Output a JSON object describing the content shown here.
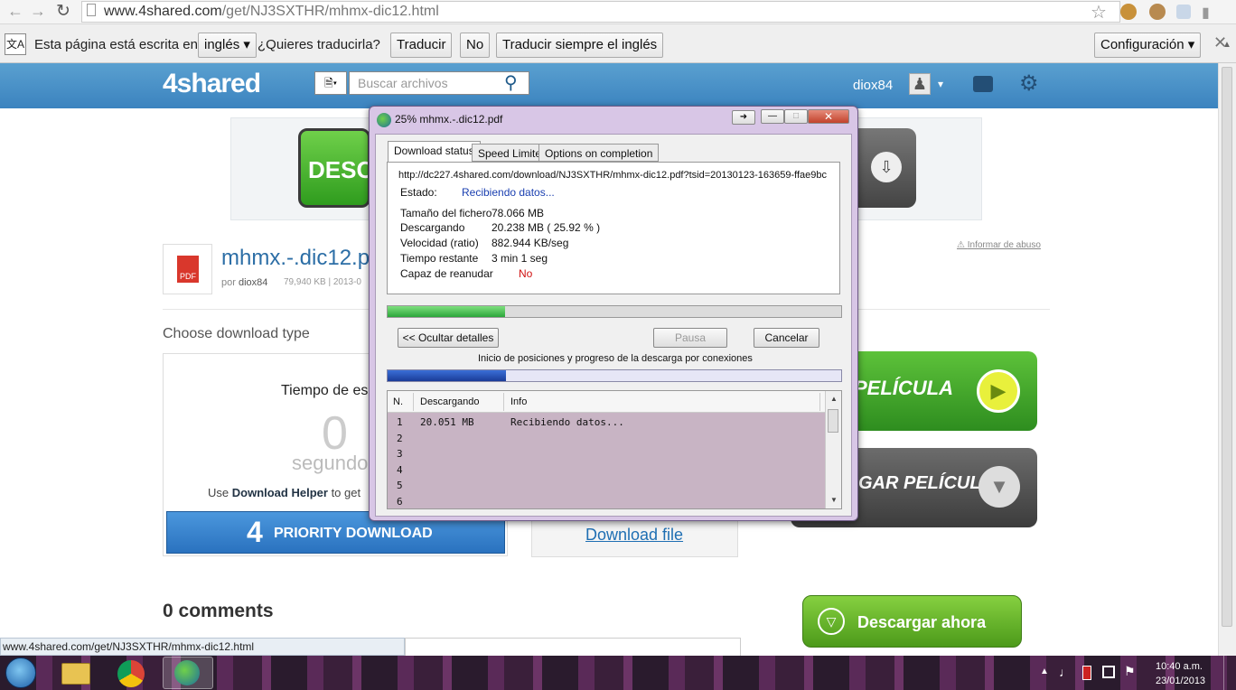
{
  "browser": {
    "url_host": "www.4shared.com",
    "url_path": "/get/NJ3SXTHR/mhmx-dic12.html"
  },
  "translate": {
    "prefix": "Esta página está escrita en",
    "language": "inglés",
    "question": "¿Quieres traducirla?",
    "translate_btn": "Traducir",
    "no_btn": "No",
    "always_btn": "Traducir siempre el inglés",
    "settings_btn": "Configuración"
  },
  "site": {
    "logo": "4shared",
    "search_placeholder": "Buscar archivos",
    "username": "diox84"
  },
  "file": {
    "title": "mhmx.-.dic12.p",
    "by_label": "por",
    "author": "diox84",
    "meta": "79,940 KB | 2013-0",
    "report": "Informar de abuso",
    "banner_text": "DESCA"
  },
  "download": {
    "choose_type": "Choose download type",
    "wait_label": "Tiempo de esp",
    "wait_value": "0",
    "wait_unit": "segundo",
    "helper_prefix": "Use",
    "helper_link": "Download Helper",
    "helper_suffix": "to get",
    "priority_number": "4",
    "priority_label": "PRIORITY DOWNLOAD",
    "download_file": "Download file",
    "movie_label": "PELÍCULA",
    "movie_label2": "GAR PELÍCULA",
    "download_now": "Descargar ahora"
  },
  "comments": {
    "title": "0 comments"
  },
  "status_url": "www.4shared.com/get/NJ3SXTHR/mhmx-dic12.html",
  "dialog": {
    "title": "25% mhmx.-.dic12.pdf",
    "tabs": [
      "Download status",
      "Speed Limiter",
      "Options on completion"
    ],
    "url": "http://dc227.4shared.com/download/NJ3SXTHR/mhmx-dic12.pdf?tsid=20130123-163659-ffae9bc",
    "estado_label": "Estado:",
    "estado_value": "Recibiendo datos...",
    "rows": [
      {
        "label": "Tamaño del fichero",
        "value": "78.066  MB"
      },
      {
        "label": "Descargando",
        "value": "20.238  MB  ( 25.92 % )"
      },
      {
        "label": "Velocidad (ratio)",
        "value": "882.944  KB/seg"
      },
      {
        "label": "Tiempo restante",
        "value": "3 min 1 seg"
      }
    ],
    "resume_label": "Capaz de reanudar",
    "resume_value": "No",
    "progress": 0.2592,
    "hide_details": "<< Ocultar detalles",
    "pause": "Pausa",
    "cancel": "Cancelar",
    "connections_caption": "Inicio de posiciones y progreso de la descarga por conexiones",
    "conn_progress": 0.26,
    "table_headers": [
      "N.",
      "Descargando",
      "Info"
    ],
    "table_rows": [
      {
        "n": "1",
        "dl": "20.051  MB",
        "info": "Recibiendo datos..."
      },
      {
        "n": "2",
        "dl": "",
        "info": ""
      },
      {
        "n": "3",
        "dl": "",
        "info": ""
      },
      {
        "n": "4",
        "dl": "",
        "info": ""
      },
      {
        "n": "5",
        "dl": "",
        "info": ""
      },
      {
        "n": "6",
        "dl": "",
        "info": ""
      }
    ]
  },
  "taskbar": {
    "time": "10:40 a.m.",
    "date": "23/01/2013"
  },
  "colors": {
    "header_blue": "#3b83bf",
    "priority_blue": "#2f7ccc",
    "green_btn": "#4aa82e",
    "dialog_frame": "#d8c6e6",
    "progress_green": "#3cb44a",
    "progress_blue": "#2b64c8"
  }
}
